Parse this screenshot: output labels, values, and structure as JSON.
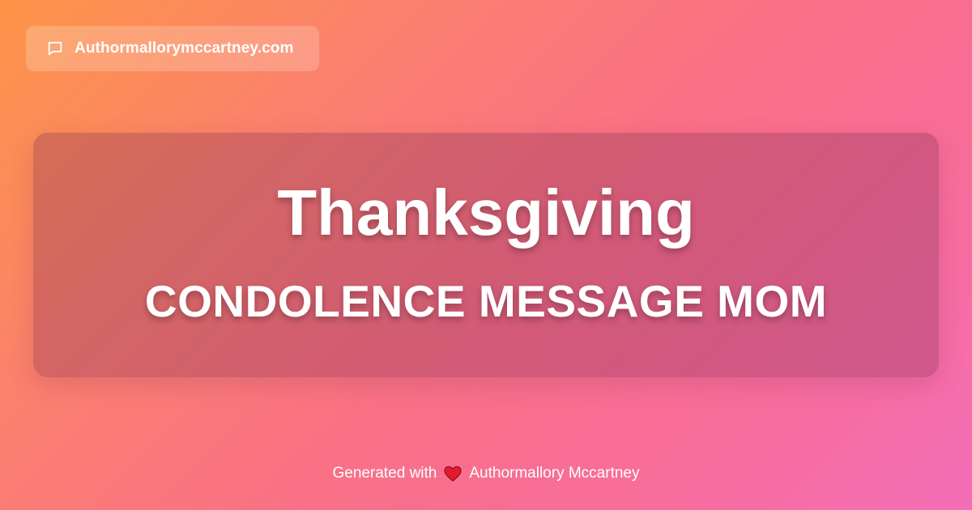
{
  "badge": {
    "icon": "chat-bubble-icon",
    "domain": "Authormallorymccartney.com"
  },
  "card": {
    "title": "Thanksgiving",
    "subtitle": "CONDOLENCE MESSAGE MOM"
  },
  "footer": {
    "prefix": "Generated with",
    "heart_icon": "heart-icon",
    "author": "Authormallory Mccartney"
  },
  "colors": {
    "gradient_start": "#fd9548",
    "gradient_end": "#f46eb8",
    "heart": "#e8192c"
  }
}
